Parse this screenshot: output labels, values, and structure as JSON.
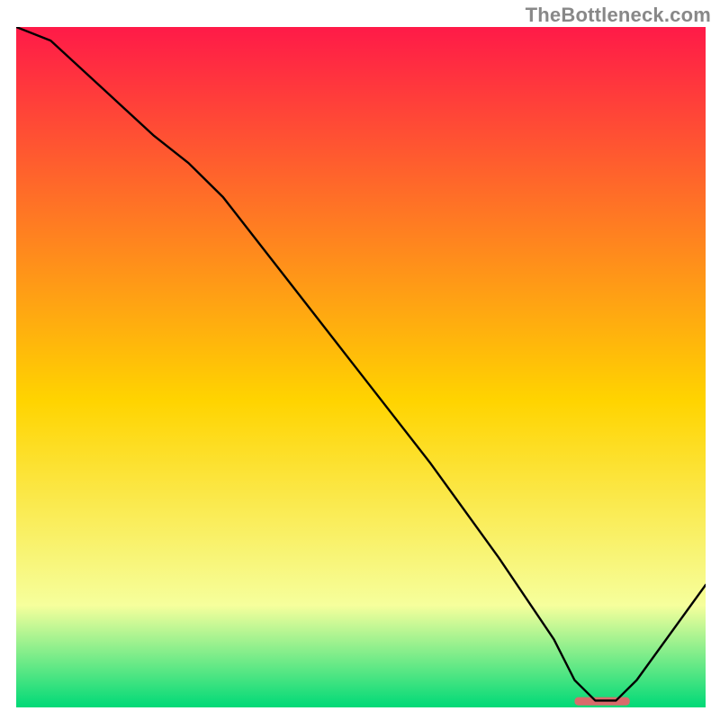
{
  "watermark": "TheBottleneck.com",
  "chart_data": {
    "type": "line",
    "title": "",
    "xlabel": "",
    "ylabel": "",
    "xlim": [
      0,
      100
    ],
    "ylim": [
      0,
      100
    ],
    "grid": false,
    "legend": false,
    "gradient": {
      "top_color": "#ff1a48",
      "mid_color": "#ffd400",
      "low_color": "#f6ff9c",
      "bottom_color": "#00d977"
    },
    "series": [
      {
        "name": "curve",
        "x": [
          0,
          5,
          20,
          25,
          30,
          40,
          50,
          60,
          70,
          78,
          81,
          84,
          87,
          90,
          100
        ],
        "y_pct": [
          100,
          98,
          84,
          80,
          75,
          62,
          49,
          36,
          22,
          10,
          4,
          1,
          1,
          4,
          18
        ]
      }
    ],
    "marker": {
      "color": "#d96b6b",
      "x_start_pct": 81,
      "x_end_pct": 89,
      "y_pct": 0.9,
      "height_pct": 1.2,
      "radius_px": 4
    }
  }
}
